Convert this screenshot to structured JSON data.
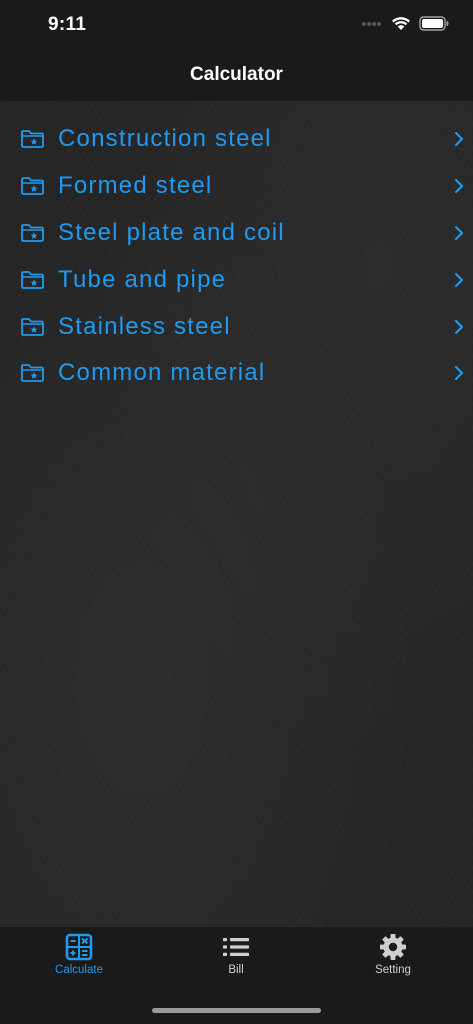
{
  "status_bar": {
    "time": "9:11"
  },
  "nav": {
    "title": "Calculator"
  },
  "list": {
    "items": [
      {
        "label": "Construction steel",
        "icon": "folder-star-icon"
      },
      {
        "label": "Formed steel",
        "icon": "folder-star-icon"
      },
      {
        "label": "Steel plate and coil",
        "icon": "folder-star-icon"
      },
      {
        "label": "Tube and pipe",
        "icon": "folder-star-icon"
      },
      {
        "label": "Stainless steel",
        "icon": "folder-star-icon"
      },
      {
        "label": "Common material",
        "icon": "folder-star-icon"
      }
    ]
  },
  "tabbar": {
    "tabs": [
      {
        "label": "Calculate",
        "icon": "calculator-icon",
        "active": true
      },
      {
        "label": "Bill",
        "icon": "list-icon",
        "active": false
      },
      {
        "label": "Setting",
        "icon": "gear-icon",
        "active": false
      }
    ]
  },
  "colors": {
    "accent": "#1e9bf0",
    "background": "#252525",
    "bar_background": "#1a1a1a",
    "inactive": "#cfcfcf"
  }
}
